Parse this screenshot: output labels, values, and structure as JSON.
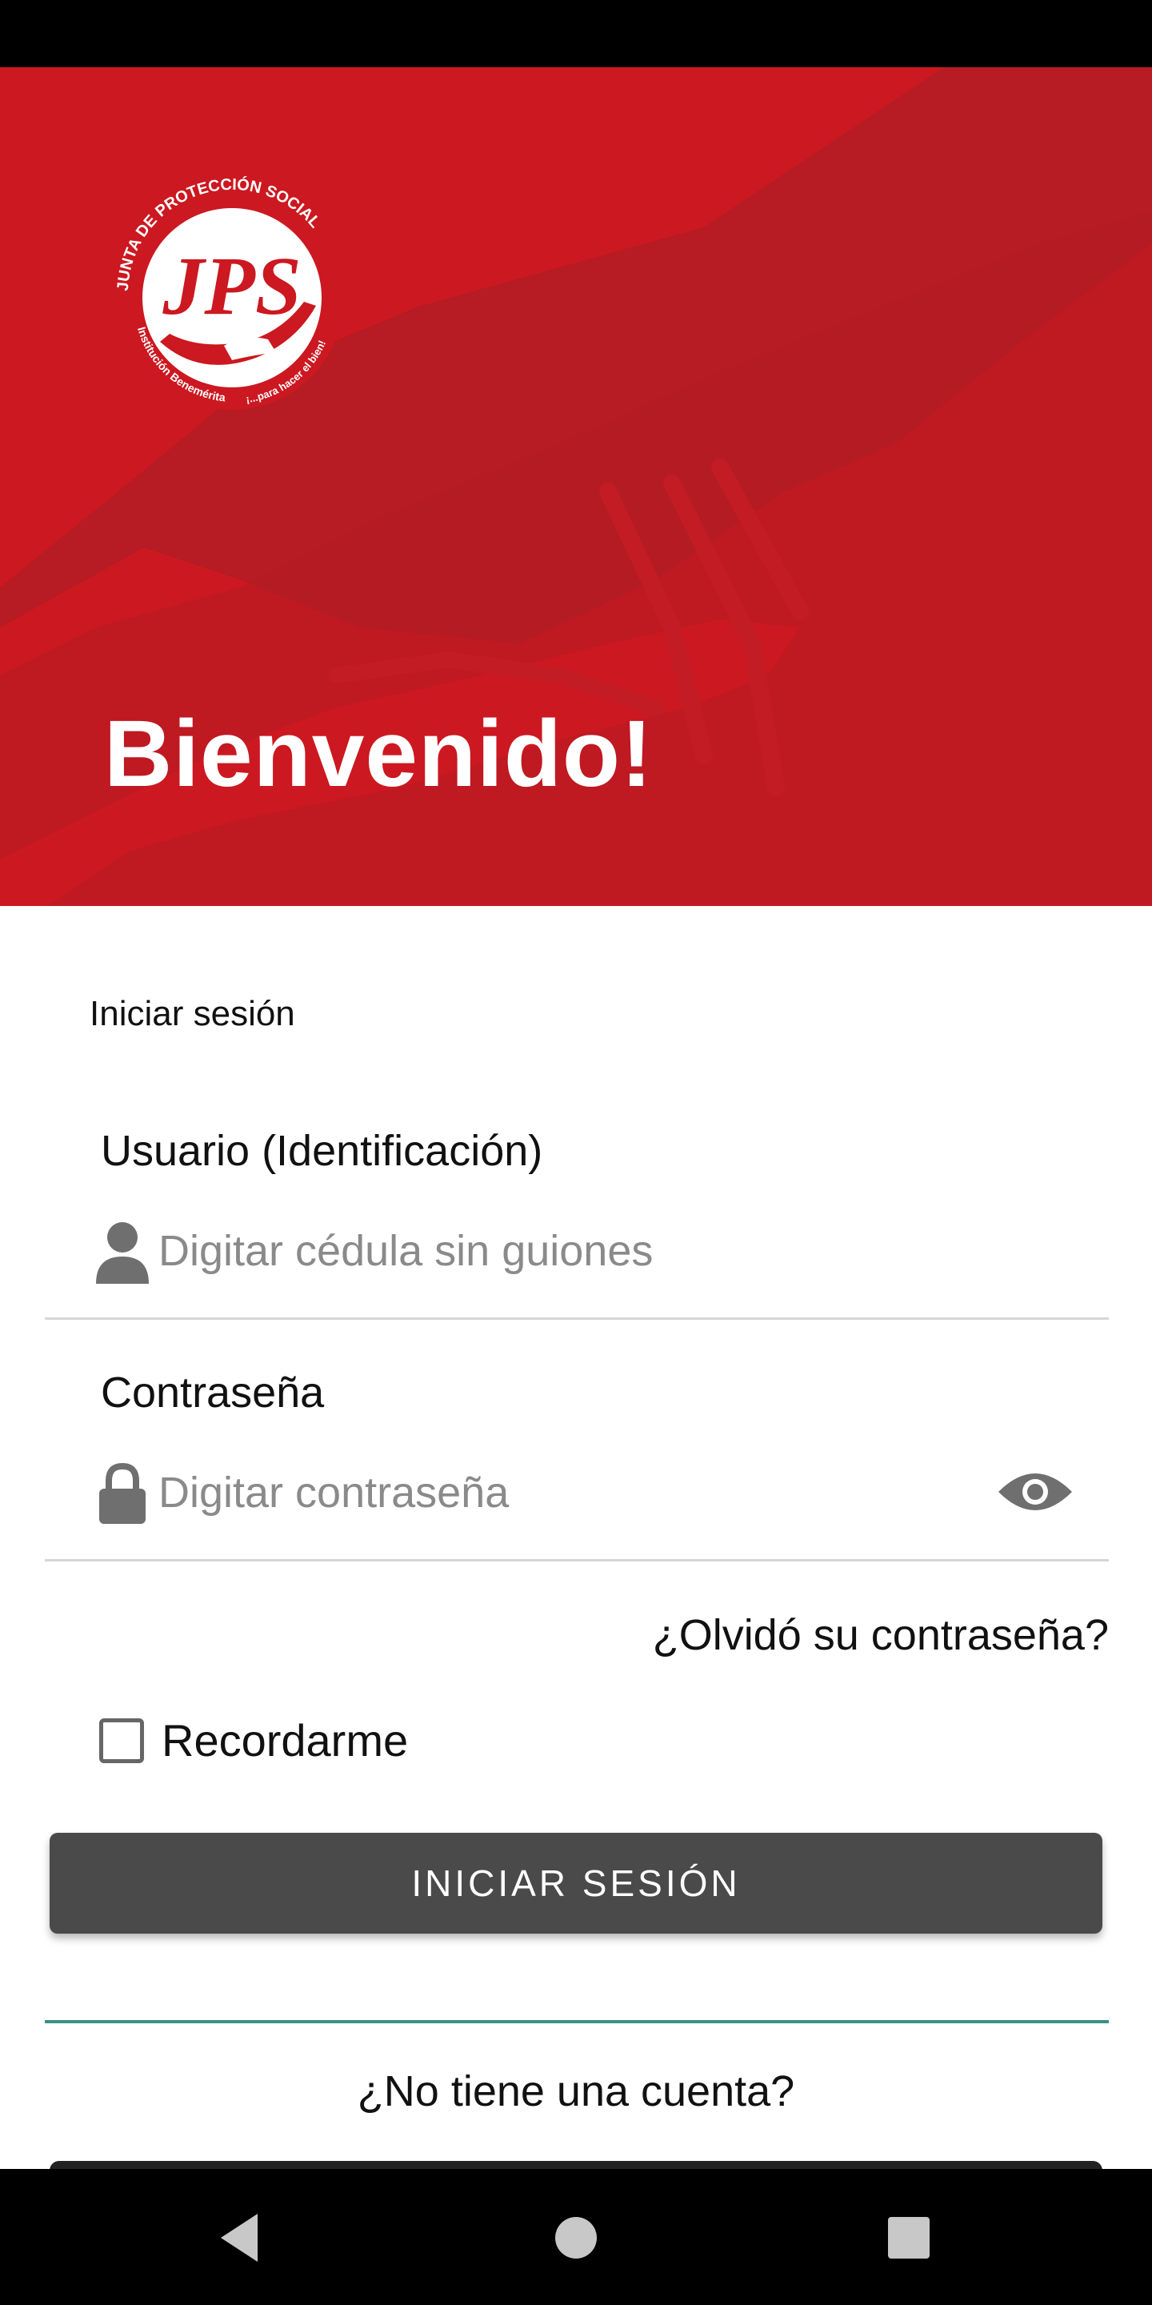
{
  "hero": {
    "welcome": "Bienvenido!",
    "logo": {
      "arc_top": "JUNTA DE PROTECCIÓN SOCIAL",
      "monogram": "JPS",
      "arc_bottom_left": "Institución Benemérita",
      "arc_bottom_right": "¡...para hacer el bien!"
    }
  },
  "login": {
    "section_title": "Iniciar sesión",
    "username": {
      "label": "Usuario (Identificación)",
      "placeholder": "Digitar cédula sin guiones",
      "icon": "person-icon"
    },
    "password": {
      "label": "Contraseña",
      "placeholder": "Digitar contraseña",
      "icon": "lock-icon",
      "toggle_icon": "eye-icon"
    },
    "forgot": "¿Olvidó su contraseña?",
    "remember": {
      "label": "Recordarme",
      "checked": false
    },
    "submit": "INICIAR SESIÓN",
    "no_account": "¿No tiene una cuenta?"
  },
  "nav": {
    "back": "back-icon",
    "home": "home-icon",
    "recents": "recents-icon"
  },
  "colors": {
    "brand_red": "#cc1820",
    "button_dark": "#4a4a4a",
    "divider_teal": "#3b8e8a"
  }
}
